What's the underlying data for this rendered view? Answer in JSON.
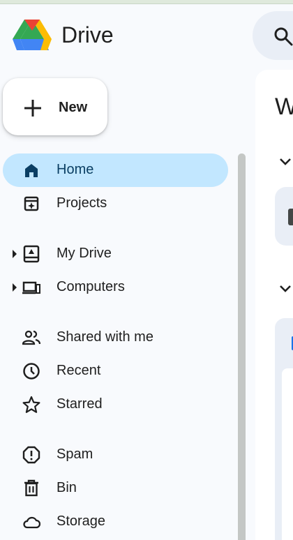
{
  "app": {
    "title": "Drive"
  },
  "new_button": {
    "label": "New"
  },
  "sidebar": {
    "items": [
      {
        "label": "Home",
        "icon": "home-icon",
        "active": true
      },
      {
        "label": "Projects",
        "icon": "projects-icon"
      },
      {
        "label": "My Drive",
        "icon": "my-drive-icon",
        "expandable": true
      },
      {
        "label": "Computers",
        "icon": "computers-icon",
        "expandable": true
      },
      {
        "label": "Shared with me",
        "icon": "shared-icon"
      },
      {
        "label": "Recent",
        "icon": "clock-icon"
      },
      {
        "label": "Starred",
        "icon": "star-icon"
      },
      {
        "label": "Spam",
        "icon": "spam-icon"
      },
      {
        "label": "Bin",
        "icon": "bin-icon"
      },
      {
        "label": "Storage",
        "icon": "cloud-icon"
      }
    ]
  },
  "main": {
    "heading_fragment": "W"
  },
  "colors": {
    "active_bg": "#c2e7ff",
    "active_text": "#0b3f64",
    "background": "#f8fafd",
    "search_bg": "#e9eef6"
  }
}
